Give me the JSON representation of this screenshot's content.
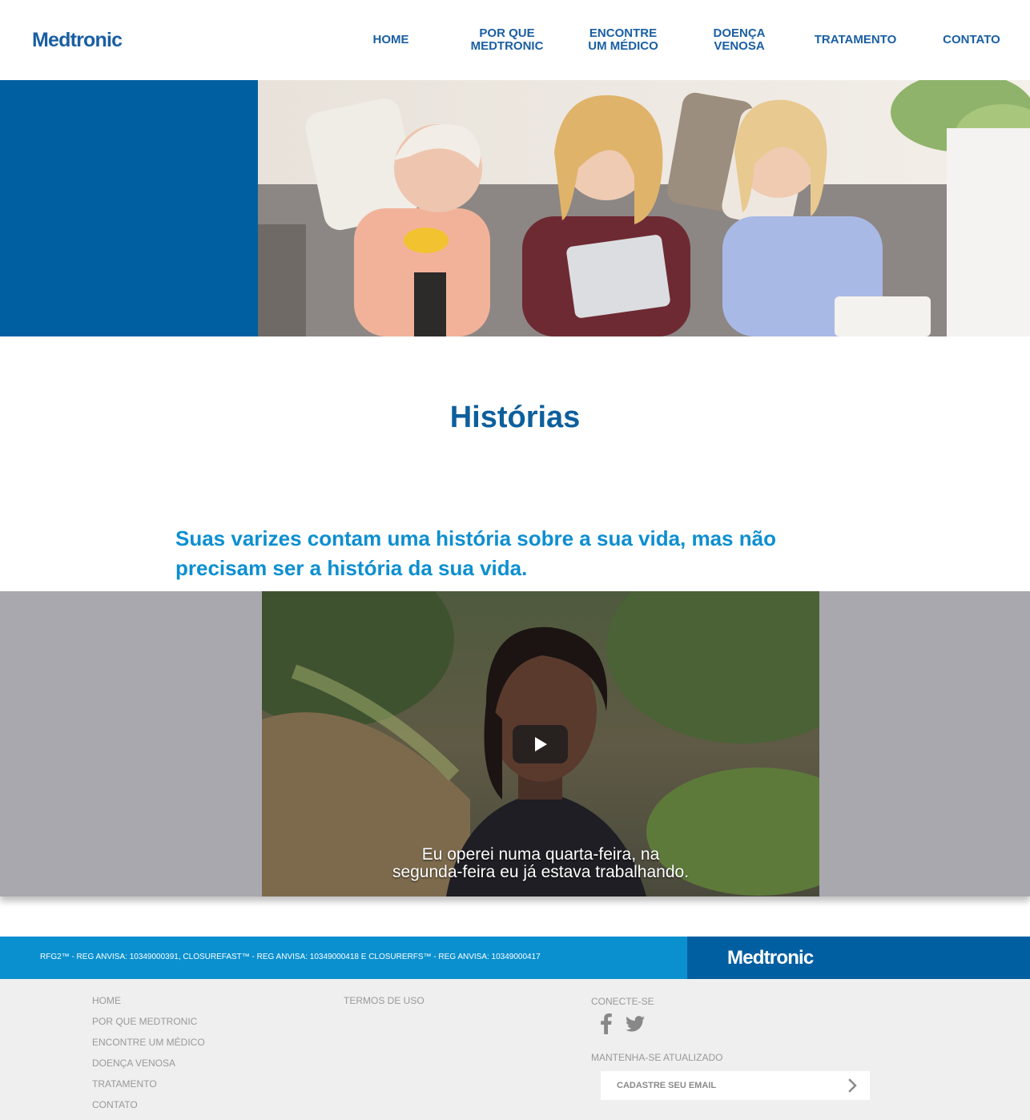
{
  "brand": {
    "logo": "Medtronic",
    "primary_color": "#005fa0",
    "accent_color": "#0a90cf",
    "title_color": "#0d5f9c"
  },
  "nav": {
    "items": [
      {
        "label": "HOME"
      },
      {
        "label": "POR QUE\nMEDTRONIC"
      },
      {
        "label": "ENCONTRE\nUM MÉDICO"
      },
      {
        "label": "DOENÇA\nVENOSA"
      },
      {
        "label": "TRATAMENTO"
      },
      {
        "label": "CONTATO"
      }
    ]
  },
  "hero": {
    "image": "hero-photo"
  },
  "main": {
    "title": "Histórias",
    "subtitle": "Suas varizes contam uma história sobre a sua vida, mas não precisam ser a história da sua vida."
  },
  "video": {
    "caption_line1": "Eu operei numa quarta-feira, na",
    "caption_line2": "segunda-feira eu já estava trabalhando.",
    "play_icon": "play-icon"
  },
  "footer": {
    "bar_text": "RFG2™ - REG ANVISA: 10349000391, CLOSUREFAST™ - REG ANVISA: 10349000418 E CLOSURERFS™ - REG ANVISA: 10349000417",
    "logo": "Medtronic",
    "links": [
      "HOME",
      "POR QUE MEDTRONIC",
      "ENCONTRE UM MÉDICO",
      "DOENÇA VENOSA",
      "TRATAMENTO",
      "CONTATO"
    ],
    "terms": "TERMOS DE USO",
    "connect_heading": "CONECTE-SE",
    "social_icons": [
      "facebook-icon",
      "twitter-icon"
    ],
    "newsletter_heading": "MANTENHA-SE ATUALIZADO",
    "email_placeholder": "CADASTRE SEU EMAIL"
  }
}
